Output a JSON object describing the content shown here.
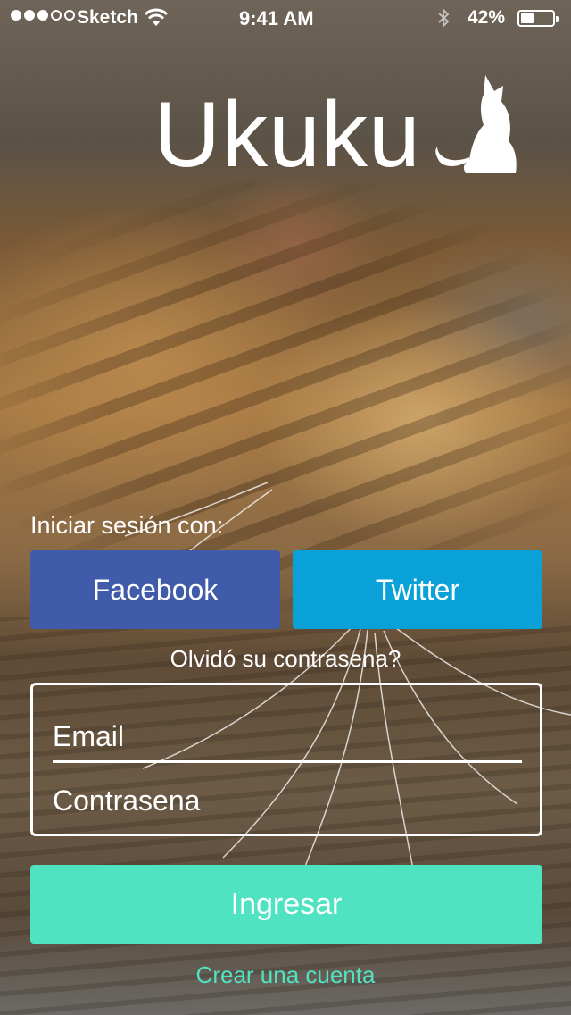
{
  "status_bar": {
    "carrier": "Sketch",
    "time": "9:41 AM",
    "battery_percent": "42%",
    "battery_level": 0.42,
    "signal_bars_filled": 3,
    "signal_bars_total": 5
  },
  "app": {
    "logo_text": "Ukuku",
    "logo_icon": "cat-icon"
  },
  "login": {
    "social_label": "Iniciar sesión con:",
    "facebook_label": "Facebook",
    "twitter_label": "Twitter",
    "forgot_password": "Olvidó su contrasena?",
    "email_placeholder": "Email",
    "password_placeholder": "Contrasena",
    "submit_label": "Ingresar",
    "create_account": "Crear una cuenta"
  },
  "colors": {
    "facebook": "#3f5ba9",
    "twitter": "#09a1d8",
    "accent": "#4fe3c1"
  }
}
